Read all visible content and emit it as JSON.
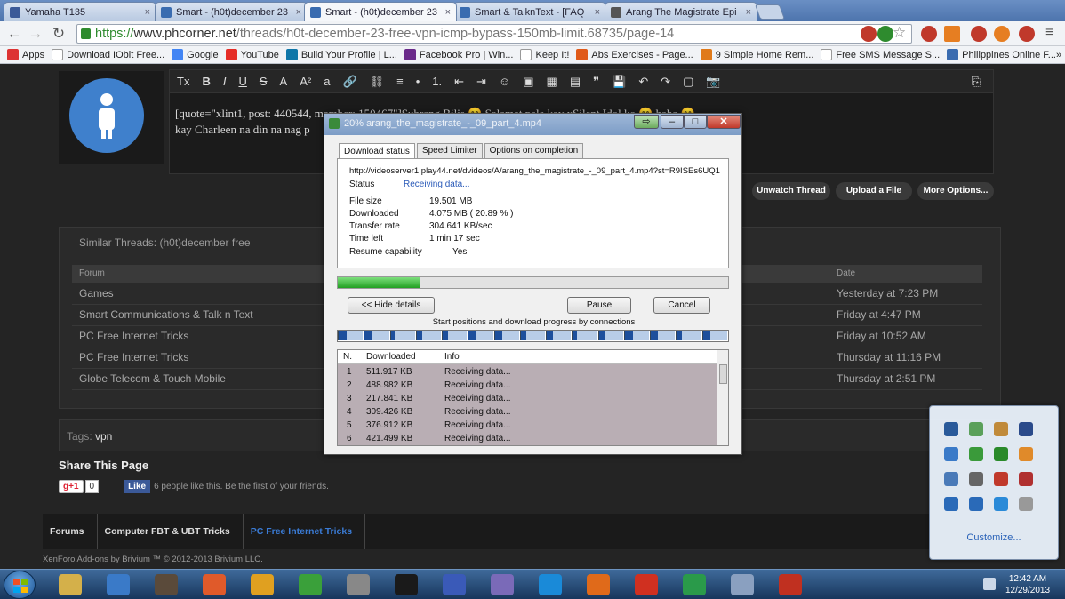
{
  "tabs": [
    {
      "title": "Yamaha T135",
      "color": "#3b5998"
    },
    {
      "title": "Smart - (h0t)december 23",
      "color": "#3a6cb0"
    },
    {
      "title": "Smart - (h0t)december 23",
      "color": "#3a6cb0",
      "active": true
    },
    {
      "title": "Smart & TalknText - [FAQ",
      "color": "#3a6cb0"
    },
    {
      "title": "Arang The Magistrate Epi",
      "color": "#555555"
    }
  ],
  "tab_close": "×",
  "nav": {
    "back": "←",
    "forward": "→",
    "reload": "↻"
  },
  "url": {
    "scheme": "https://",
    "domain": "www.phcorner.net",
    "path": "/threads/h0t-december-23-free-vpn-icmp-bypass-150mb-limit.68735/page-14"
  },
  "star": "☆",
  "bookmarks": [
    {
      "label": "Apps",
      "color": "#d33"
    },
    {
      "label": "Download IObit Free...",
      "color": "#ffffff"
    },
    {
      "label": "Google",
      "color": "#4285f4"
    },
    {
      "label": "YouTube",
      "color": "#e52d27"
    },
    {
      "label": "Build Your Profile | L...",
      "color": "#0e76a8"
    },
    {
      "label": "Facebook Pro | Win...",
      "color": "#6a2a8a"
    },
    {
      "label": "Keep It!",
      "color": "#ffffff"
    },
    {
      "label": "Abs Exercises - Page...",
      "color": "#e05a1a"
    },
    {
      "label": "9 Simple Home Rem...",
      "color": "#e07a1a"
    },
    {
      "label": "Free SMS Message S...",
      "color": "#ffffff"
    },
    {
      "label": "Philippines Online F...",
      "color": "#3a6cb0"
    }
  ],
  "bookmarks_more": "»",
  "editor": {
    "tools": [
      "Tx",
      "B",
      "I",
      "U",
      "S",
      "A",
      "A²",
      "a",
      "🔗",
      "⛓",
      "≡",
      "•",
      "1.",
      "⇤",
      "⇥",
      "☺",
      "▣",
      "▦",
      "▤",
      "❞",
      "💾",
      "↶",
      "↷",
      "▢",
      "📷",
      "⎘"
    ],
    "quote_line1": "[quote=\"xlint1, post: 440544, member: 150467\"]Subrang Bilis 😊 Salamat pala kay xSilent Idol ko 😊 haha 😊",
    "quote_line2": "kay Charleen na din na nag p"
  },
  "post_buttons": [
    "Unwatch Thread",
    "Upload a File",
    "More Options..."
  ],
  "similar": {
    "title": "Similar Threads: (h0t)december free",
    "col_forum": "Forum",
    "col_date": "Date",
    "rows": [
      {
        "forum": "Games",
        "date": "Yesterday at 7:23 PM"
      },
      {
        "forum": "Smart Communications & Talk n Text",
        "date": "Friday at 4:47 PM"
      },
      {
        "forum": "PC Free Internet Tricks",
        "date": "Friday at 10:52 AM"
      },
      {
        "forum": "PC Free Internet Tricks",
        "date": "Thursday at 11:16 PM"
      },
      {
        "forum": "Globe Telecom & Touch Mobile",
        "date": "Thursday at 2:51 PM"
      }
    ]
  },
  "tags": {
    "label": "Tags:",
    "value": "vpn"
  },
  "share": {
    "title": "Share This Page",
    "gplus": "g+1",
    "count": "0",
    "like": "Like",
    "text": "6 people like this. Be the first of your friends."
  },
  "breadcrumb": [
    "Forums",
    "Computer FBT & UBT Tricks",
    "PC Free Internet Tricks"
  ],
  "footer": "XenForo Add-ons by Brivium ™ © 2012-2013 Brivium LLC.",
  "download": {
    "title": "20% arang_the_magistrate_-_09_part_4.mp4",
    "tabs": [
      "Download status",
      "Speed Limiter",
      "Options on completion"
    ],
    "url": "http://videoserver1.play44.net/dvideos/A/arang_the_magistrate_-_09_part_4.mp4?st=R9ISEs6UQ1",
    "status_label": "Status",
    "status_value": "Receiving data...",
    "fields": [
      {
        "label": "File size",
        "value": "19.501  MB"
      },
      {
        "label": "Downloaded",
        "value": "4.075  MB  ( 20.89 % )"
      },
      {
        "label": "Transfer rate",
        "value": "304.641  KB/sec"
      },
      {
        "label": "Time left",
        "value": "1 min 17 sec"
      },
      {
        "label": "Resume capability",
        "value": "Yes"
      }
    ],
    "progress": 0.2089,
    "btn_hide": "<< Hide details",
    "btn_pause": "Pause",
    "btn_cancel": "Cancel",
    "conn_caption": "Start positions and download progress by connections",
    "conn_progress": [
      0.3,
      0.25,
      0.15,
      0.2,
      0.2,
      0.25,
      0.3,
      0.2,
      0.25,
      0.15,
      0.2,
      0.3,
      0.25,
      0.2,
      0.3
    ],
    "list_head": {
      "n": "N.",
      "downloaded": "Downloaded",
      "info": "Info"
    },
    "connections": [
      {
        "n": "1",
        "downloaded": "511.917  KB",
        "info": "Receiving data..."
      },
      {
        "n": "2",
        "downloaded": "488.982  KB",
        "info": "Receiving data..."
      },
      {
        "n": "3",
        "downloaded": "217.841  KB",
        "info": "Receiving data..."
      },
      {
        "n": "4",
        "downloaded": "309.426  KB",
        "info": "Receiving data..."
      },
      {
        "n": "5",
        "downloaded": "376.912  KB",
        "info": "Receiving data..."
      },
      {
        "n": "6",
        "downloaded": "421.499  KB",
        "info": "Receiving data..."
      }
    ]
  },
  "tray": {
    "customize": "Customize...",
    "icons": [
      "#2a5a9a",
      "#5aa05a",
      "#c08a3a",
      "#2a4a8a",
      "#3a7ac8",
      "#3a9a3a",
      "#2a8a2a",
      "#e08a2a",
      "#4a7ab8",
      "#666666",
      "#c0392b",
      "#b03030",
      "#2a6ab8",
      "#2a6ab8",
      "#2a8ad8",
      "#999999"
    ]
  },
  "clock": {
    "time": "12:42 AM",
    "date": "12/29/2013"
  },
  "taskbar": [
    "#d4b04a",
    "#3a7ac8",
    "#5a4a3a",
    "#e05a2a",
    "#e0a020",
    "#3aa03a",
    "#888888",
    "#1a1a1a",
    "#3a5ab8",
    "#7a6ab8",
    "#1a8ad8",
    "#e06a1a",
    "#d03020",
    "#2a9a4a",
    "#8aa0c0",
    "#c03020"
  ]
}
